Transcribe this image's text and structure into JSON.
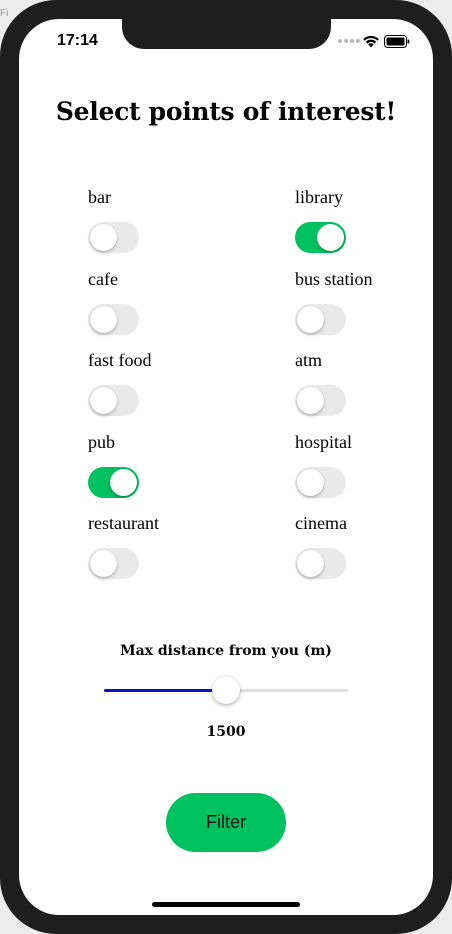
{
  "background_fragment": "Fi",
  "status_bar": {
    "time": "17:14"
  },
  "title": "Select points of interest!",
  "poi": {
    "left": [
      {
        "label": "bar",
        "on": false
      },
      {
        "label": "cafe",
        "on": false
      },
      {
        "label": "fast food",
        "on": false
      },
      {
        "label": "pub",
        "on": true
      },
      {
        "label": "restaurant",
        "on": false
      }
    ],
    "right": [
      {
        "label": "library",
        "on": true
      },
      {
        "label": "bus station",
        "on": false
      },
      {
        "label": "atm",
        "on": false
      },
      {
        "label": "hospital",
        "on": false
      },
      {
        "label": "cinema",
        "on": false
      }
    ]
  },
  "distance": {
    "label": "Max distance from you (m)",
    "value": "1500",
    "fraction": 0.5
  },
  "filter_button": {
    "label": "Filter"
  },
  "colors": {
    "toggle_on": "#00c15f",
    "toggle_off": "#e9e9ea",
    "slider_fill": "#0a12c8",
    "button": "#00c15f"
  }
}
